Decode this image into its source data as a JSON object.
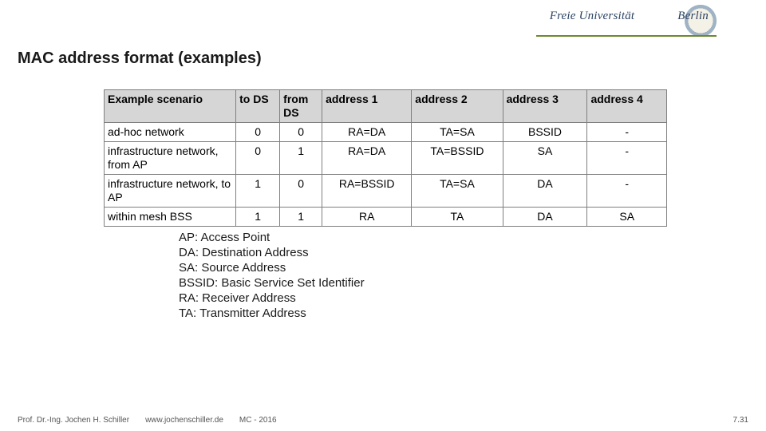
{
  "header": {
    "logo_text_left": "Freie Universität",
    "logo_text_right": "Berlin",
    "seal_name": "fu-berlin-seal"
  },
  "title": "MAC address format (examples)",
  "chart_data": {
    "type": "table",
    "columns": [
      "Example scenario",
      "to DS",
      "from DS",
      "address 1",
      "address 2",
      "address 3",
      "address 4"
    ],
    "rows": [
      [
        "ad-hoc network",
        "0",
        "0",
        "RA=DA",
        "TA=SA",
        "BSSID",
        "-"
      ],
      [
        "infrastructure network, from AP",
        "0",
        "1",
        "RA=DA",
        "TA=BSSID",
        "SA",
        "-"
      ],
      [
        "infrastructure network, to AP",
        "1",
        "0",
        "RA=BSSID",
        "TA=SA",
        "DA",
        "-"
      ],
      [
        "within mesh BSS",
        "1",
        "1",
        "RA",
        "TA",
        "DA",
        "SA"
      ]
    ]
  },
  "legend": {
    "ap": "AP: Access Point",
    "da": "DA: Destination Address",
    "sa": "SA: Source Address",
    "bssid": "BSSID: Basic Service Set Identifier",
    "ra": "RA: Receiver Address",
    "ta": "TA: Transmitter Address"
  },
  "footer": {
    "author": "Prof. Dr.-Ing. Jochen H. Schiller",
    "site": "www.jochenschiller.de",
    "course": "MC - 2016",
    "page": "7.31"
  }
}
